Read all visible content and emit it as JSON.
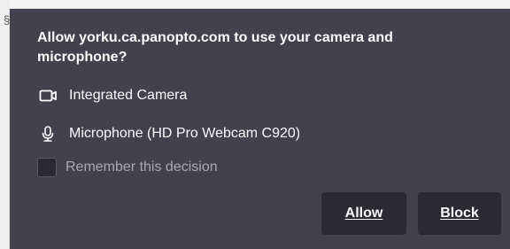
{
  "background_fragment": {
    "glyph": "§"
  },
  "dialog": {
    "title": "Allow yorku.ca.panopto.com to use your camera and microphone?",
    "devices": [
      {
        "icon": "camera-icon",
        "label": "Integrated Camera"
      },
      {
        "icon": "microphone-icon",
        "label": "Microphone (HD Pro Webcam C920)"
      }
    ],
    "remember_label": "Remember this decision",
    "allow_label": "Allow",
    "block_label": "Block"
  },
  "colors": {
    "panel": "#42414d",
    "button": "#2b2a33",
    "text": "#fbfbfe",
    "muted_text": "#a9a9b4"
  }
}
